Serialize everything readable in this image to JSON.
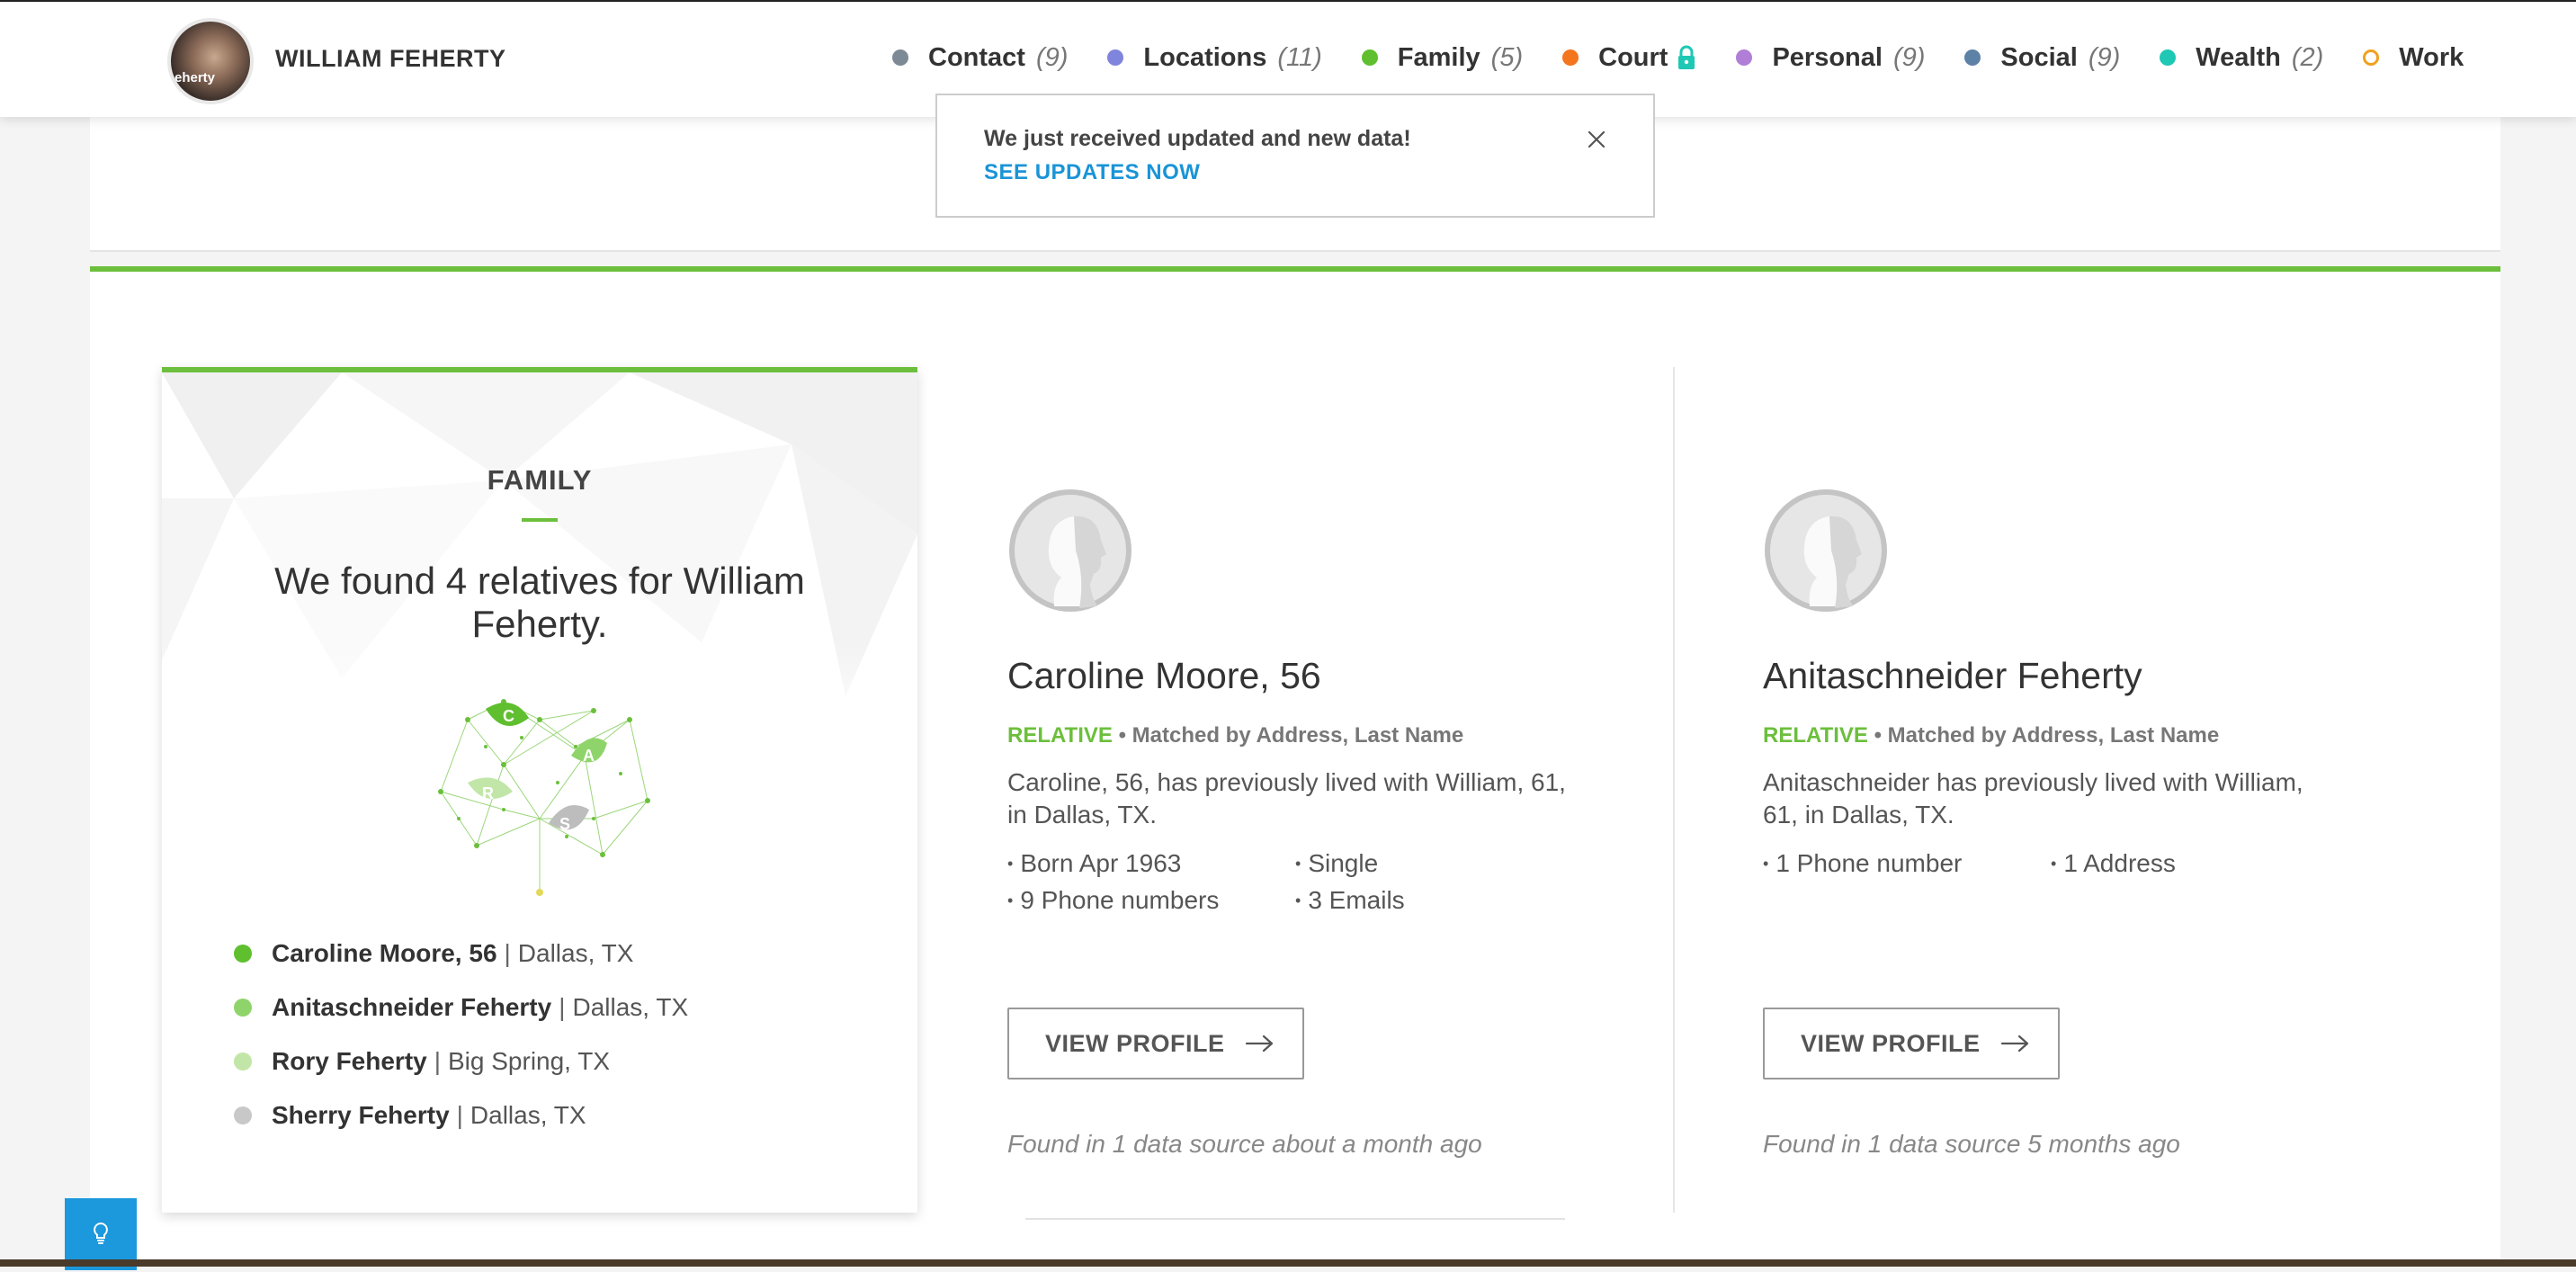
{
  "header": {
    "name": "WILLIAM FEHERTY",
    "avatar_text": "eherty",
    "nav": [
      {
        "label": "Contact",
        "count": "(9)",
        "color": "#7d8a96",
        "style": "filled"
      },
      {
        "label": "Locations",
        "count": "(11)",
        "color": "#7f85dc",
        "style": "filled"
      },
      {
        "label": "Family",
        "count": "(5)",
        "color": "#5fbf2e",
        "style": "filled"
      },
      {
        "label": "Court",
        "count": "",
        "color": "#f4751e",
        "style": "filled",
        "locked": true
      },
      {
        "label": "Personal",
        "count": "(9)",
        "color": "#b07ed6",
        "style": "filled"
      },
      {
        "label": "Social",
        "count": "(9)",
        "color": "#5e82a6",
        "style": "filled"
      },
      {
        "label": "Wealth",
        "count": "(2)",
        "color": "#1ec8b4",
        "style": "filled"
      },
      {
        "label": "Work",
        "count": "",
        "color": "#f0a11d",
        "style": "outline"
      }
    ]
  },
  "notification": {
    "message": "We just received updated and new data!",
    "link": "SEE UPDATES NOW"
  },
  "family_card": {
    "title": "FAMILY",
    "headline": "We found 4 relatives for William Feherty.",
    "tree_letters": [
      "C",
      "A",
      "R",
      "S"
    ],
    "relatives": [
      {
        "name": "Caroline Moore, 56",
        "sep": "|",
        "city": "Dallas, TX",
        "color": "#5fbf2e"
      },
      {
        "name": "Anitaschneider Feherty",
        "sep": "|",
        "city": "Dallas, TX",
        "color": "#8fd46a"
      },
      {
        "name": "Rory Feherty",
        "sep": "|",
        "city": "Big Spring, TX",
        "color": "#c2e6a8"
      },
      {
        "name": "Sherry Feherty",
        "sep": "|",
        "city": "Dallas, TX",
        "color": "#c8c8c8"
      }
    ]
  },
  "relative_cards": [
    {
      "name": "Caroline Moore, 56",
      "tag": "RELATIVE",
      "bullet": "•",
      "match": "Matched by Address, Last Name",
      "description": "Caroline, 56, has previously lived with William, 61, in Dallas, TX.",
      "facts": [
        "Born Apr 1963",
        "Single",
        "9 Phone numbers",
        "3 Emails"
      ],
      "button": "VIEW PROFILE",
      "found": "Found in 1 data source about a month ago"
    },
    {
      "name": "Anitaschneider Feherty",
      "tag": "RELATIVE",
      "bullet": "•",
      "match": "Matched by Address, Last Name",
      "description": "Anitaschneider has previously lived with William, 61, in Dallas, TX.",
      "facts": [
        "1 Phone number",
        "1 Address"
      ],
      "button": "VIEW PROFILE",
      "found": "Found in 1 data source 5 months ago"
    }
  ],
  "colors": {
    "accent_green": "#6cbf3c",
    "link_blue": "#1a94d6",
    "help_blue": "#1c98dc"
  },
  "icons": {
    "close": "close-icon",
    "lock": "lock-icon",
    "arrow": "arrow-right-icon",
    "help": "lightbulb-icon"
  }
}
